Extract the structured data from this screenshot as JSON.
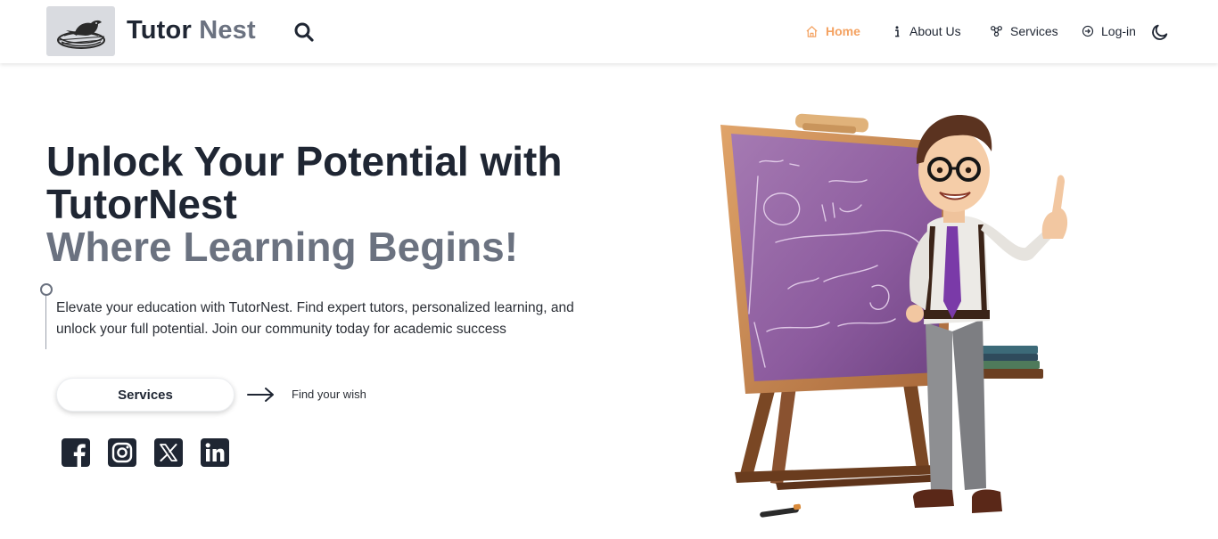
{
  "header": {
    "brand_part1": "Tutor",
    "brand_part2": "Nest",
    "nav": [
      {
        "label": "Home",
        "icon": "home-icon",
        "active": true
      },
      {
        "label": "About Us",
        "icon": "info-icon",
        "active": false
      },
      {
        "label": "Services",
        "icon": "services-icon",
        "active": false
      },
      {
        "label": "Log-in",
        "icon": "login-icon",
        "active": false
      }
    ],
    "theme_toggle_icon": "moon-icon"
  },
  "hero": {
    "title_line1": "Unlock Your Potential with",
    "title_line2": "TutorNest",
    "title_line3": "Where Learning Begins!",
    "description": "Elevate your education with TutorNest. Find expert tutors, personalized learning, and unlock your full potential. Join our community today for academic success",
    "cta_label": "Services",
    "cta_hint": "Find your wish"
  },
  "social": [
    "facebook-icon",
    "instagram-icon",
    "x-icon",
    "linkedin-icon"
  ],
  "colors": {
    "accent": "#f4a261",
    "text_dark": "#1f2633",
    "text_muted": "#6b7280",
    "board": "#8f5fa0",
    "board_frame": "#c88a4c"
  }
}
